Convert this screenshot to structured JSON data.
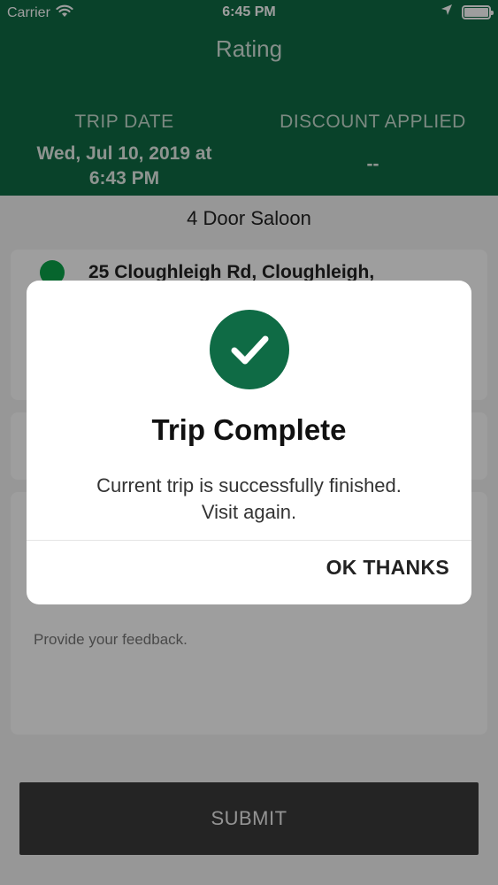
{
  "status_bar": {
    "carrier": "Carrier",
    "time": "6:45 PM",
    "icons": [
      "wifi-icon",
      "location-arrow-icon",
      "battery-icon"
    ]
  },
  "header": {
    "title": "Rating",
    "trip_date_label": "TRIP DATE",
    "trip_date_value_line1": "Wed, Jul 10, 2019 at",
    "trip_date_value_line2": "6:43 PM",
    "discount_label": "DISCOUNT APPLIED",
    "discount_value": "--"
  },
  "trip": {
    "vehicle": "4 Door Saloon",
    "pickup_address": "25 Cloughleigh Rd, Cloughleigh,"
  },
  "feedback": {
    "placeholder": "Provide your feedback."
  },
  "submit_label": "SUBMIT",
  "dialog": {
    "icon": "check-icon",
    "title": "Trip Complete",
    "message_line1": "Current trip is successfully finished.",
    "message_line2": "Visit again.",
    "button_label": "OK THANKS"
  },
  "colors": {
    "brand_green": "#0f6b45",
    "pickup_dot": "#0aa34a",
    "submit_bg": "#3a3a3a"
  }
}
